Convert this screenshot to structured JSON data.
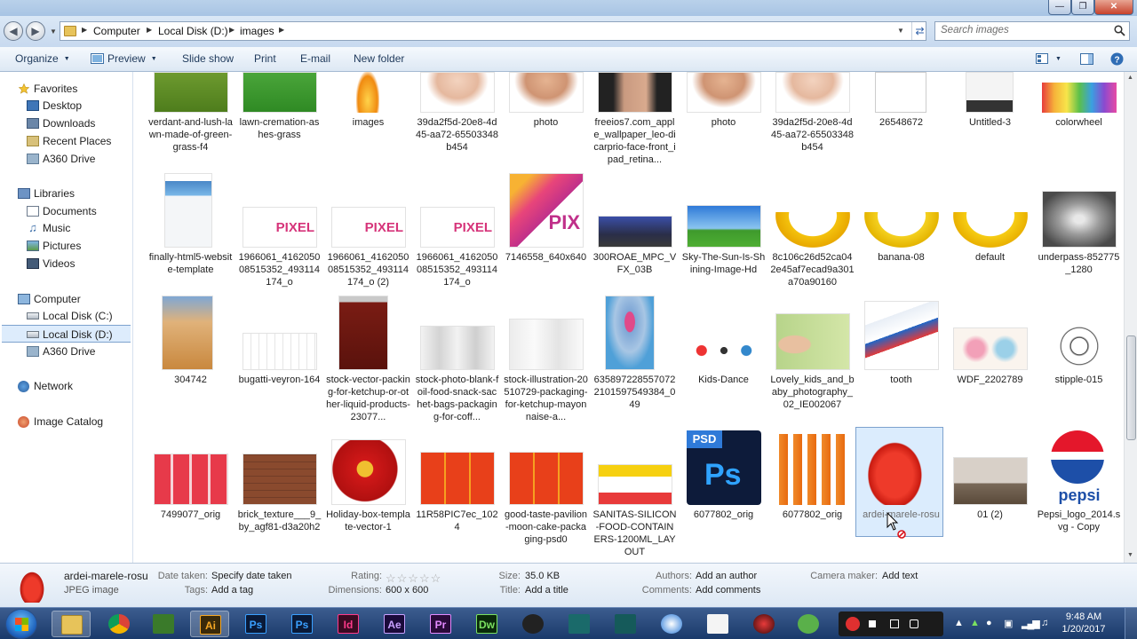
{
  "window": {
    "minimize_label": "—",
    "maximize_label": "❐",
    "close_label": "✕"
  },
  "address": {
    "crumbs": [
      "Computer",
      "Local Disk (D:)",
      "images"
    ]
  },
  "search": {
    "placeholder": "Search images"
  },
  "toolbar": {
    "organize": "Organize",
    "preview": "Preview",
    "slideshow": "Slide show",
    "print": "Print",
    "email": "E-mail",
    "new_folder": "New folder"
  },
  "sidebar": {
    "favorites": "Favorites",
    "desktop": "Desktop",
    "downloads": "Downloads",
    "recent_places": "Recent Places",
    "a360": "A360 Drive",
    "libraries": "Libraries",
    "documents": "Documents",
    "music": "Music",
    "pictures": "Pictures",
    "videos": "Videos",
    "computer": "Computer",
    "local_c": "Local Disk (C:)",
    "local_d": "Local Disk (D:)",
    "a360_2": "A360 Drive",
    "network": "Network",
    "image_catalog": "Image Catalog"
  },
  "files": [
    {
      "name": "verdant-and-lush-lawn-made-of-green-grass-f4"
    },
    {
      "name": "lawn-cremation-ashes-grass"
    },
    {
      "name": "images"
    },
    {
      "name": "39da2f5d-20e8-4d45-aa72-65503348b454"
    },
    {
      "name": "photo"
    },
    {
      "name": "freeios7.com_apple_wallpaper_leo-dicarprio-face-front_ipad_retina..."
    },
    {
      "name": "photo"
    },
    {
      "name": "39da2f5d-20e8-4d45-aa72-65503348b454"
    },
    {
      "name": "26548672"
    },
    {
      "name": "Untitled-3"
    },
    {
      "name": "colorwheel"
    },
    {
      "name": "finally-html5-website-template"
    },
    {
      "name": "1966061_416205008515352_493114174_o"
    },
    {
      "name": "1966061_416205008515352_493114174_o (2)"
    },
    {
      "name": "1966061_416205008515352_493114174_o"
    },
    {
      "name": "7146558_640x640"
    },
    {
      "name": "300ROAE_MPC_VFX_03B"
    },
    {
      "name": "Sky-The-Sun-Is-Shining-Image-Hd"
    },
    {
      "name": "8c106c26d52ca042e45af7ecad9a301a70a90160"
    },
    {
      "name": "banana-08"
    },
    {
      "name": "default"
    },
    {
      "name": "underpass-852775_1280"
    },
    {
      "name": "304742"
    },
    {
      "name": "bugatti-veyron-164"
    },
    {
      "name": "stock-vector-packing-for-ketchup-or-other-liquid-products-23077..."
    },
    {
      "name": "stock-photo-blank-foil-food-snack-sachet-bags-packaging-for-coff..."
    },
    {
      "name": "stock-illustration-20510729-packaging-for-ketchup-mayonnaise-a..."
    },
    {
      "name": "6358972285570722101597549384_049"
    },
    {
      "name": "Kids-Dance"
    },
    {
      "name": "Lovely_kids_and_baby_photography_02_IE002067"
    },
    {
      "name": "tooth"
    },
    {
      "name": "WDF_2202789"
    },
    {
      "name": "stipple-015"
    },
    {
      "name": "7499077_orig"
    },
    {
      "name": "brick_texture___9_by_agf81-d3a20h2"
    },
    {
      "name": "Holiday-box-template-vector-1"
    },
    {
      "name": "11R58PIC7ec_1024"
    },
    {
      "name": "good-taste-pavilion-moon-cake-packaging-psd0"
    },
    {
      "name": "SANITAS-SILICON-FOOD-CONTAINERS-1200ML_LAYOUT"
    },
    {
      "name": "6077802_orig"
    },
    {
      "name": "6077802_orig"
    },
    {
      "name": "ardei-marele-rosu"
    },
    {
      "name": "01 (2)"
    },
    {
      "name": "Pepsi_logo_2014.svg - Copy"
    }
  ],
  "thumb_text": {
    "pixel": "PIXEL",
    "pix": "PIX",
    "psd": "PSD",
    "ps": "Ps",
    "pepsi": "pepsi"
  },
  "details": {
    "filename": "ardei-marele-rosu",
    "filetype": "JPEG image",
    "date_taken_label": "Date taken:",
    "date_taken_value": "Specify date taken",
    "tags_label": "Tags:",
    "tags_value": "Add a tag",
    "rating_label": "Rating:",
    "rating_stars": "☆☆☆☆☆",
    "dimensions_label": "Dimensions:",
    "dimensions_value": "600 x 600",
    "size_label": "Size:",
    "size_value": "35.0 KB",
    "title_label": "Title:",
    "title_value": "Add a title",
    "authors_label": "Authors:",
    "authors_value": "Add an author",
    "comments_label": "Comments:",
    "comments_value": "Add comments",
    "camera_label": "Camera maker:",
    "camera_value": "Add text"
  },
  "taskbar": {
    "apps": [
      "Ai",
      "Ps",
      "Ps",
      "Id",
      "Ae",
      "Pr",
      "Dw"
    ],
    "time": "9:48 AM",
    "date": "1/20/2017"
  },
  "colors": {
    "accent": "#3a6ea5",
    "selection": "#cce4fc",
    "taskbar": "#1f3f6f"
  }
}
